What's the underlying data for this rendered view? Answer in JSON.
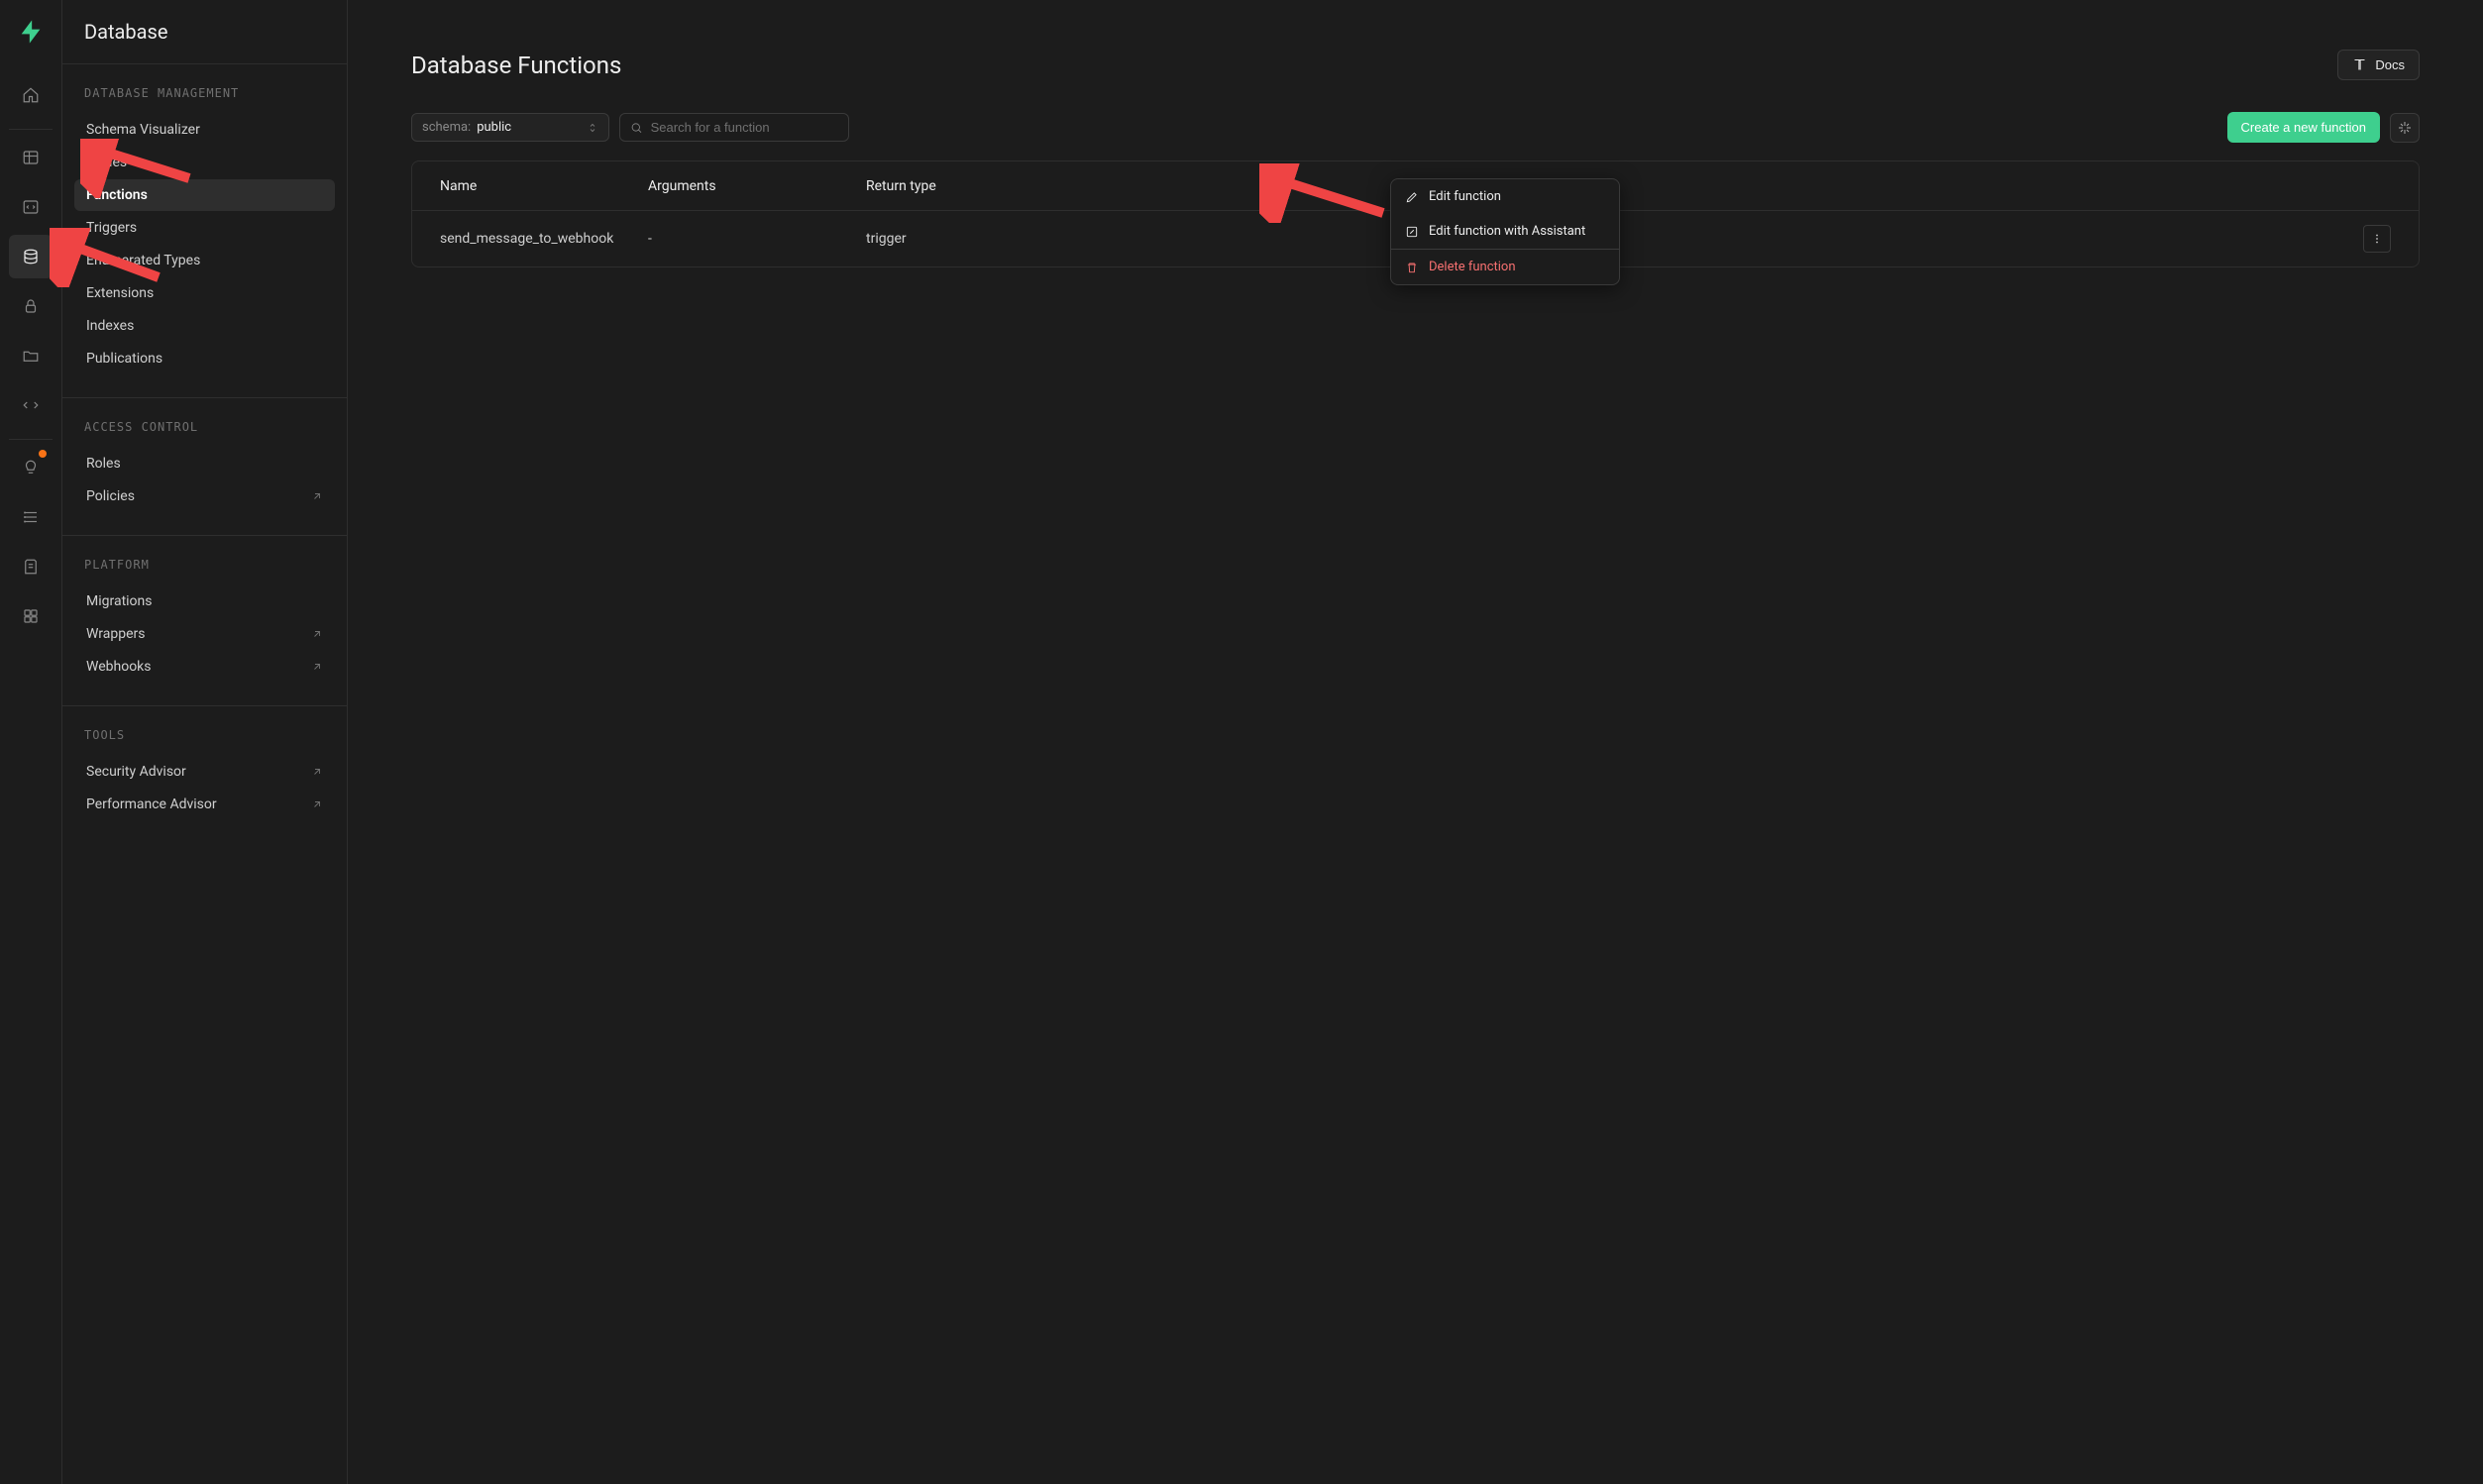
{
  "sidebar": {
    "title": "Database",
    "sections": [
      {
        "header": "DATABASE MANAGEMENT",
        "items": [
          {
            "label": "Schema Visualizer",
            "external": false,
            "active": false
          },
          {
            "label": "Tables",
            "external": false,
            "active": false
          },
          {
            "label": "Functions",
            "external": false,
            "active": true
          },
          {
            "label": "Triggers",
            "external": false,
            "active": false
          },
          {
            "label": "Enumerated Types",
            "external": false,
            "active": false
          },
          {
            "label": "Extensions",
            "external": false,
            "active": false
          },
          {
            "label": "Indexes",
            "external": false,
            "active": false
          },
          {
            "label": "Publications",
            "external": false,
            "active": false
          }
        ]
      },
      {
        "header": "ACCESS CONTROL",
        "items": [
          {
            "label": "Roles",
            "external": false,
            "active": false
          },
          {
            "label": "Policies",
            "external": true,
            "active": false
          }
        ]
      },
      {
        "header": "PLATFORM",
        "items": [
          {
            "label": "Migrations",
            "external": false,
            "active": false
          },
          {
            "label": "Wrappers",
            "external": true,
            "active": false
          },
          {
            "label": "Webhooks",
            "external": true,
            "active": false
          }
        ]
      },
      {
        "header": "TOOLS",
        "items": [
          {
            "label": "Security Advisor",
            "external": true,
            "active": false
          },
          {
            "label": "Performance Advisor",
            "external": true,
            "active": false
          }
        ]
      }
    ]
  },
  "page": {
    "title": "Database Functions",
    "docs_label": "Docs",
    "schema_label": "schema:",
    "schema_value": "public",
    "search_placeholder": "Search for a function",
    "create_label": "Create a new function"
  },
  "table": {
    "columns": [
      "Name",
      "Arguments",
      "Return type",
      ""
    ],
    "rows": [
      {
        "name": "send_message_to_webhook",
        "arguments": "-",
        "return_type": "trigger"
      }
    ]
  },
  "context_menu": {
    "edit": "Edit function",
    "edit_ai": "Edit function with Assistant",
    "delete": "Delete function"
  }
}
